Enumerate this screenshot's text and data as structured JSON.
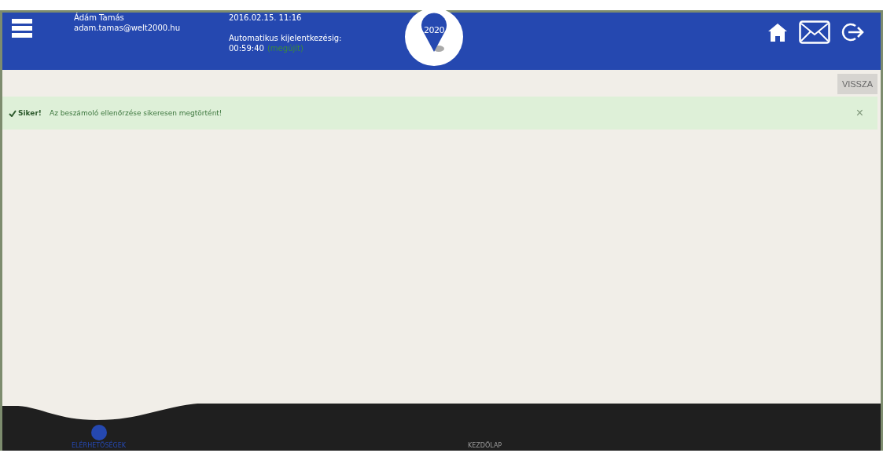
{
  "header": {
    "user_name": "Ádám Tamás",
    "user_email": "adam.tamas@welt2000.hu",
    "datetime": "2016.02.15. 11:16",
    "logout_label": "Automatikus kijelentkezésig:",
    "logout_timer": "00:59:40",
    "renew_link": "(megújít)",
    "logo_text": "2020"
  },
  "back_button": "VISSZA",
  "alert": {
    "kind": "success",
    "title": "Siker!",
    "message": "Az beszámoló ellenőrzése sikeresen megtörtént!",
    "close": "×"
  },
  "footer": {
    "items": [
      {
        "label": "ELÉRHETŐSÉGEK",
        "selected": true
      },
      {
        "label": "KEZDŐLAP",
        "selected": false
      }
    ]
  }
}
